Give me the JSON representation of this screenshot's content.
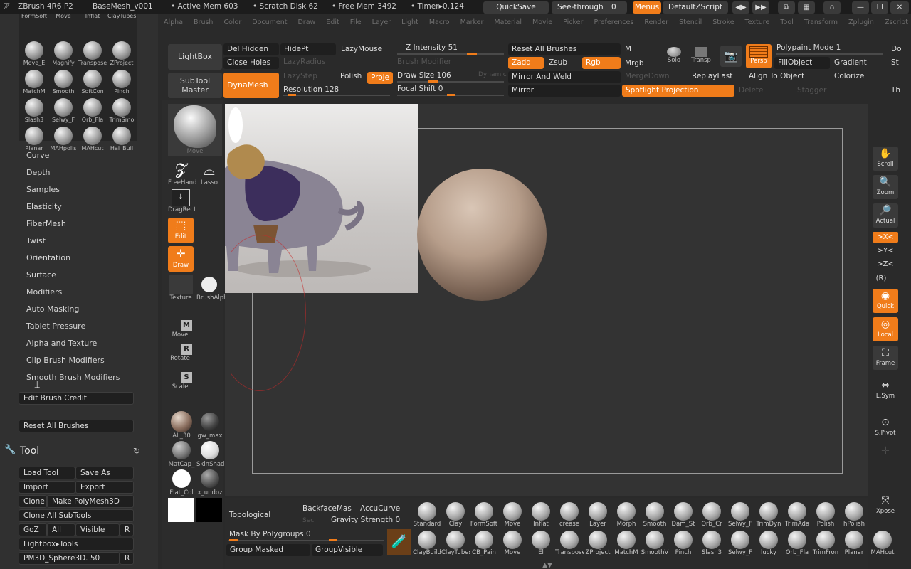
{
  "titlebar": {
    "app": "ZBrush 4R6 P2",
    "project": "BaseMesh_v001",
    "active_mem": "• Active Mem 603",
    "scratch_disk": "• Scratch Disk 62",
    "free_mem": "• Free Mem 3492",
    "timer": "• Timer▸0.124",
    "quicksave": "QuickSave",
    "see_through": "See-through",
    "see_through_val": "0",
    "menus": "Menus",
    "defaultzscript": "DefaultZScript"
  },
  "menubar": [
    "Alpha",
    "Brush",
    "Color",
    "Document",
    "Draw",
    "Edit",
    "File",
    "Layer",
    "Light",
    "Macro",
    "Marker",
    "Material",
    "Movie",
    "Picker",
    "Preferences",
    "Render",
    "Stencil",
    "Stroke",
    "Texture",
    "Tool",
    "Transform",
    "Zplugin",
    "Zscript"
  ],
  "brush_grid": [
    {
      "label": "FormSoft"
    },
    {
      "label": "Move"
    },
    {
      "label": "Inflat"
    },
    {
      "label": "ClayTubes"
    },
    {
      "label": "Move_E"
    },
    {
      "label": "Magnify"
    },
    {
      "label": "Transpose"
    },
    {
      "label": "ZProject"
    },
    {
      "label": "MatchM"
    },
    {
      "label": "Smooth"
    },
    {
      "label": "SoftCon"
    },
    {
      "label": "Pinch"
    },
    {
      "label": "Slash3"
    },
    {
      "label": "Selwy_F"
    },
    {
      "label": "Orb_Fla"
    },
    {
      "label": "TrimSmo"
    },
    {
      "label": "Planar"
    },
    {
      "label": "MAHpolis"
    },
    {
      "label": "MAHcut"
    },
    {
      "label": "Hai_Buil"
    }
  ],
  "brush_subpalettes": [
    "Curve",
    "Depth",
    "Samples",
    "Elasticity",
    "FiberMesh",
    "Twist",
    "Orientation",
    "Surface",
    "Modifiers",
    "Auto Masking",
    "Tablet Pressure",
    "Alpha and Texture",
    "Clip Brush Modifiers",
    "Smooth Brush Modifiers"
  ],
  "brush_buttons": {
    "edit_credit": "Edit Brush Credit",
    "reset_all": "Reset All Brushes"
  },
  "tool": {
    "title": "Tool",
    "load": "Load Tool",
    "save_as": "Save As",
    "import": "Import",
    "export": "Export",
    "clone": "Clone",
    "make_polymesh": "Make PolyMesh3D",
    "clone_all": "Clone All SubTools",
    "goz": "GoZ",
    "all": "All",
    "visible": "Visible",
    "r": "R",
    "lightbox_tools": "Lightbox▸Tools",
    "current_tool": "PM3D_Sphere3D. 50"
  },
  "shelf": {
    "move": "Move",
    "freehand": "FreeHand",
    "lasso": "Lasso",
    "dragrect": "DragRect",
    "edit": "Edit",
    "draw": "Draw",
    "texture": "Texture",
    "brushalpha": "BrushAlpha",
    "move_m": "Move",
    "rotate": "Rotate",
    "scale": "Scale",
    "mat1": "AL_30",
    "mat2": "gw_max",
    "mat3": "MatCap_",
    "mat4": "SkinShad",
    "flat": "Flat_Col",
    "undoz": "x_undoz"
  },
  "toppalette": {
    "lightbox": "LightBox",
    "subtool_master": "SubTool Master",
    "dynamesh": "DynaMesh",
    "del_hidden": "Del Hidden",
    "hidept": "HidePt",
    "lazymouse": "LazyMouse",
    "close_holes": "Close Holes",
    "lazyradius": "LazyRadius",
    "lazystep": "LazyStep",
    "polish": "Polish",
    "project": "Proje",
    "resolution": "Resolution 128",
    "z_intensity": "Z Intensity 51",
    "brush_modifier": "Brush Modifier",
    "draw_size": "Draw Size 106",
    "dynamic": "Dynamic",
    "focal_shift": "Focal Shift 0",
    "reset_all_brushes": "Reset All Brushes",
    "zadd": "Zadd",
    "zsub": "Zsub",
    "rgb": "Rgb",
    "m": "M",
    "mrgb": "Mrgb",
    "mirror_weld": "Mirror And Weld",
    "mirror": "Mirror",
    "mergedown": "MergeDown",
    "replaylast": "ReplayLast",
    "align": "Align To Object",
    "colorize": "Colorize",
    "solo": "Solo",
    "transp": "Transp",
    "persp": "Persp",
    "polypaint_mode": "Polypaint Mode 1",
    "fillobject": "FillObject",
    "gradient": "Gradient",
    "spotlight": "Spotlight Projection",
    "delete": "Delete",
    "stagger": "Stagger",
    "do": "Do",
    "st": "St",
    "th": "Th"
  },
  "rightshelf": {
    "scroll": "Scroll",
    "zoom": "Zoom",
    "actual": "Actual",
    "x": ">X<",
    "y": ">Y<",
    "z": ">Z<",
    "r": "(R)",
    "quick": "Quick",
    "local": "Local",
    "frame": "Frame",
    "lsym": "L.Sym",
    "spivot": "S.Pivot",
    "xpose": "Xpose"
  },
  "bottom": {
    "topological": "Topological",
    "backfacemask": "BackfaceMas",
    "accucurve": "AccuCurve",
    "gravity": "Gravity Strength 0",
    "mask_polygroups": "Mask By Polygroups 0",
    "group_masked": "Group Masked",
    "groupvisible": "GroupVisible",
    "sec": "Sec"
  },
  "bottom_brushes_row1": [
    {
      "label": "Standard"
    },
    {
      "label": "Clay"
    },
    {
      "label": "FormSoft"
    },
    {
      "label": "Move"
    },
    {
      "label": "Inflat"
    },
    {
      "label": "crease"
    },
    {
      "label": "Layer"
    },
    {
      "label": "Morph"
    },
    {
      "label": "Smooth"
    },
    {
      "label": "Dam_St"
    },
    {
      "label": "Orb_Cr"
    },
    {
      "label": "Selwy_F"
    },
    {
      "label": "TrimDyn"
    },
    {
      "label": "TrimAda"
    },
    {
      "label": "Polish"
    },
    {
      "label": "hPolish"
    }
  ],
  "bottom_brushes_row2": [
    {
      "label": "ClayBuild"
    },
    {
      "label": "ClayTubes"
    },
    {
      "label": "CB_Pain"
    },
    {
      "label": "Move"
    },
    {
      "label": "El"
    },
    {
      "label": "Transpose"
    },
    {
      "label": "ZProject"
    },
    {
      "label": "MatchM"
    },
    {
      "label": "SmoothV"
    },
    {
      "label": "Pinch"
    },
    {
      "label": "Slash3"
    },
    {
      "label": "Selwy_F"
    },
    {
      "label": "lucky"
    },
    {
      "label": "Orb_Fla"
    },
    {
      "label": "TrimFron"
    },
    {
      "label": "Planar"
    },
    {
      "label": "MAHcut"
    }
  ],
  "colors": {
    "accent": "#f07c1a",
    "panel": "#303030",
    "background": "#2a2a2a"
  },
  "slider_levels": {
    "z_intensity": 51,
    "draw_size": 106,
    "focal_shift": 0,
    "resolution": 128
  }
}
